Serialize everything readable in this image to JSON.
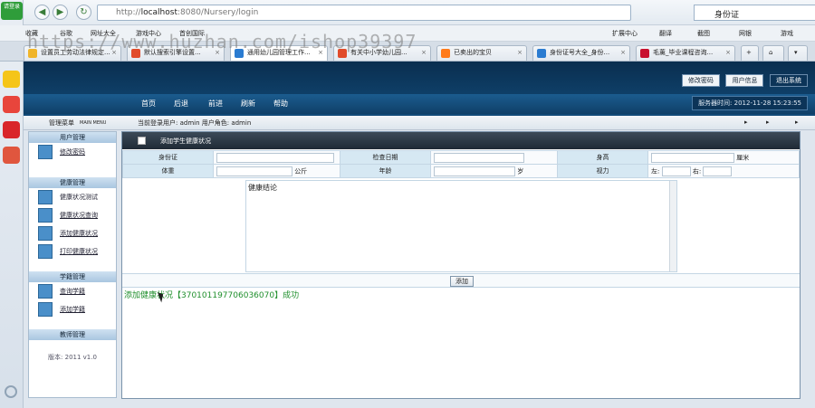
{
  "browser": {
    "login_label": "请登录",
    "url_prefix": "http://",
    "url_host": "localhost",
    "url_rest": ":8080/Nursery/login",
    "search_value": "身份证",
    "bookmarks": [
      "收藏",
      "谷歌",
      "网址大全",
      "游戏中心",
      "首创国际",
      "扩展中心",
      "翻译",
      "截图",
      "网银",
      "游戏"
    ],
    "tabs": [
      {
        "label": "设置员工劳动法律规定..."
      },
      {
        "label": "默认搜索引擎设置..."
      },
      {
        "label": "通用幼儿园管理工作..."
      },
      {
        "label": "有关中小学幼儿园..."
      },
      {
        "label": "已卖出的宝贝"
      },
      {
        "label": "身份证号大全_身份..."
      },
      {
        "label": "毛薰_毕业课程咨询..."
      }
    ],
    "watermark": "https://www.huzhan.com/ishop39397"
  },
  "header": {
    "top_buttons": [
      "修改密码",
      "用户信息",
      "退出系统"
    ],
    "nav": [
      "首页",
      "后退",
      "前进",
      "刷新",
      "帮助"
    ],
    "server_time": "服务器时间: 2012-11-28 15:23:55"
  },
  "status": {
    "menu_title": "管理菜单",
    "menu_sub": "MAIN MENU",
    "current_user": "当前登录用户: admin  用户角色: admin"
  },
  "menu": {
    "groups": [
      {
        "title": "用户管理",
        "items": [
          "修改密码"
        ]
      },
      {
        "title": "健康管理",
        "items": [
          "健康状况测试",
          "健康状况查询",
          "添加健康状况",
          "打印健康状况"
        ]
      },
      {
        "title": "学籍管理",
        "items": [
          "查询学籍",
          "添加学籍"
        ]
      },
      {
        "title": "教师管理",
        "items": []
      }
    ],
    "version": "版本: 2011 v1.0"
  },
  "form": {
    "title": "添加学生健康状况",
    "labels": {
      "idcard": "身份证",
      "check_date": "检查日期",
      "height": "身高",
      "height_unit": "厘米",
      "weight": "体重",
      "weight_unit": "公斤",
      "age": "年龄",
      "age_unit": "岁",
      "vision": "视力",
      "left": "左:",
      "right": "右:",
      "conclusion": "健康结论"
    },
    "add_button": "添加",
    "success_message": "添加健康状况【370101197706036070】成功"
  }
}
